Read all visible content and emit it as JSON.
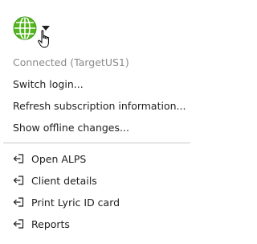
{
  "toolbar": {
    "globe_icon": "globe-icon",
    "dropdown_icon": "chevron-down-icon",
    "cursor_icon": "hand-pointer-icon",
    "globe_color": "#53b51e"
  },
  "menu": {
    "status": "Connected (TargetUS1)",
    "items": [
      {
        "label": "Switch login..."
      },
      {
        "label": "Refresh subscription information..."
      },
      {
        "label": "Show offline changes..."
      }
    ],
    "links": [
      {
        "label": "Open ALPS",
        "icon": "exit-icon"
      },
      {
        "label": "Client details",
        "icon": "exit-icon"
      },
      {
        "label": "Print Lyric ID card",
        "icon": "exit-icon"
      },
      {
        "label": "Reports",
        "icon": "exit-icon"
      }
    ]
  }
}
